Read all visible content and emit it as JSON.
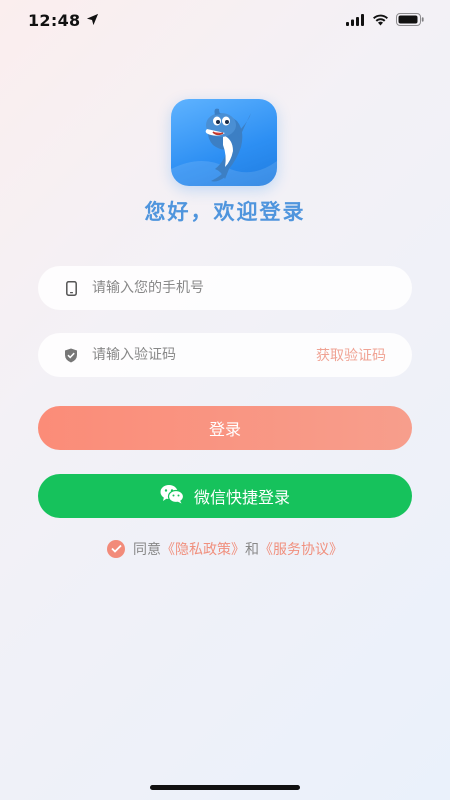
{
  "status_bar": {
    "time": "12:48",
    "icons": [
      "location-arrow-icon",
      "signal-icon",
      "wifi-icon",
      "battery-icon"
    ]
  },
  "app": {
    "logo_icon": "dolphin-mascot-icon",
    "welcome_text": "您好，欢迎登录"
  },
  "form": {
    "phone": {
      "icon": "phone-icon",
      "value": "",
      "placeholder": "请输入您的手机号"
    },
    "code": {
      "icon": "shield-icon",
      "value": "",
      "placeholder": "请输入验证码",
      "get_code_label": "获取验证码"
    },
    "login_label": "登录",
    "wechat_label": "微信快捷登录",
    "wechat_icon": "wechat-icon"
  },
  "agreement": {
    "checked": true,
    "prefix": "同意",
    "privacy_link": "《隐私政策》",
    "and": "和",
    "service_link": "《服务协议》"
  },
  "colors": {
    "welcome": "#4f95dd",
    "login_button": "#fb8c78",
    "wechat_button": "#16c25c",
    "link": "#f0907e",
    "get_code": "#f0a394"
  }
}
